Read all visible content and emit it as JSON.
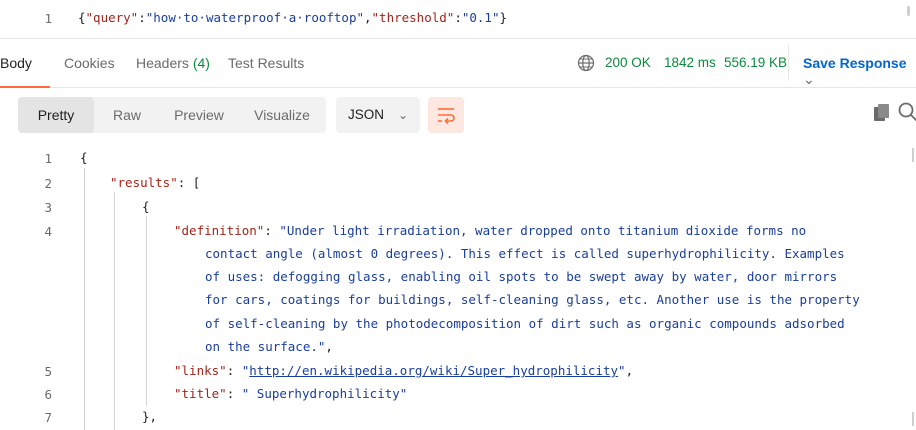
{
  "request_editor": {
    "line_number": "1",
    "open_brace": "{",
    "query_key": "\"query\"",
    "query_value": "\"how·to·waterproof·a·rooftop\"",
    "threshold_key": "\"threshold\"",
    "threshold_value": "\"0.1\"",
    "close_brace": "}"
  },
  "response_tabs": {
    "body": "Body",
    "cookies": "Cookies",
    "headers": "Headers",
    "headers_count": "(4)",
    "test_results": "Test Results"
  },
  "status": {
    "code": "200 OK",
    "time": "1842 ms",
    "size": "556.19 KB",
    "save_label": "Save Response",
    "save_chevron": "⌄"
  },
  "viewer": {
    "modes": [
      "Pretty",
      "Raw",
      "Preview",
      "Visualize"
    ],
    "format": "JSON",
    "format_chevron": "⌄"
  },
  "code": {
    "line_numbers": [
      "1",
      "2",
      "3",
      "4",
      "5",
      "6",
      "7"
    ],
    "l1": "{",
    "l2_key": "\"results\"",
    "l2_rest": ": [",
    "l3": "{",
    "l4_key": "\"definition\"",
    "l4_sep": ": ",
    "definition_lines": [
      "\"Under light irradiation, water dropped onto titanium dioxide forms no",
      "contact angle (almost 0 degrees). This effect is called superhydrophilicity. Examples",
      "of uses: defogging glass, enabling oil spots to be swept away by water, door mirrors",
      "for cars, coatings for buildings, self-cleaning glass, etc. Another use is the property",
      "of self-cleaning by the photodecomposition of dirt such as organic compounds adsorbed",
      "on the surface.\""
    ],
    "definition_tail": ",",
    "l5_key": "\"links\"",
    "l5_sep": ": ",
    "l5_quote_open": "\"",
    "l5_url": "http://en.wikipedia.org/wiki/Super_hydrophilicity",
    "l5_quote_close": "\"",
    "l5_tail": ",",
    "l6_key": "\"title\"",
    "l6_sep": ": ",
    "l6_value": "\" Superhydrophilicity\"",
    "l7": "},"
  },
  "colors": {
    "accent": "#ff6c37",
    "status_green": "#0c8a3c",
    "link_blue": "#0265d2",
    "json_key": "#a3241a",
    "json_string": "#1a3e9e"
  }
}
